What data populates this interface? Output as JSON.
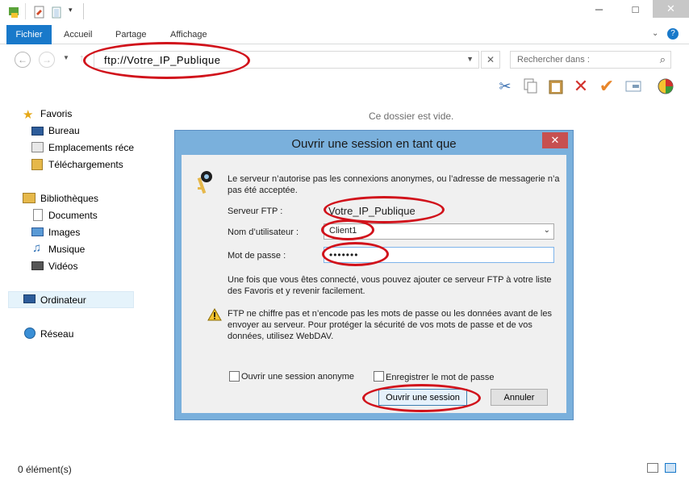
{
  "ribbon": {
    "tabs": [
      "Fichier",
      "Accueil",
      "Partage",
      "Affichage"
    ]
  },
  "window": {
    "minimize": "─",
    "maximize": "□",
    "close": "✕"
  },
  "address": {
    "value": "ftp://Votre_IP_Publique",
    "search_placeholder": "Rechercher dans :"
  },
  "nav": {
    "favorites": "Favoris",
    "fav_items": [
      "Bureau",
      "Emplacements réce",
      "Téléchargements"
    ],
    "libraries": "Bibliothèques",
    "lib_items": [
      "Documents",
      "Images",
      "Musique",
      "Vidéos"
    ],
    "computer": "Ordinateur",
    "network": "Réseau"
  },
  "content": {
    "empty_message": "Ce dossier est vide."
  },
  "status": {
    "item_count": "0 élément(s)"
  },
  "dialog": {
    "title": "Ouvrir une session en tant que",
    "info_line1": "Le serveur n’autorise pas les connexions anonymes, ou l’adresse de messagerie n’a",
    "info_line2": "pas été acceptée.",
    "server_label": "Serveur FTP :",
    "server_value": "Votre_IP_Publique",
    "username_label": "Nom d’utilisateur :",
    "username_value": "Client1",
    "password_label": "Mot de passe :",
    "password_value": "•••••••",
    "hint_line1": "Une fois que vous êtes connecté, vous pouvez ajouter ce serveur FTP à votre liste",
    "hint_line2": "des Favoris et y revenir facilement.",
    "warning_line1": "FTP ne chiffre pas et n’encode pas les mots de passe ou les données avant de les",
    "warning_line2": "envoyer au serveur. Pour protéger la sécurité de vos mots de passe et de vos",
    "warning_line3": "données, utilisez WebDAV.",
    "anonymous_label": "Ouvrir une session anonyme",
    "save_password_label": "Enregistrer le mot de passe",
    "login_button": "Ouvrir une session",
    "cancel_button": "Annuler"
  },
  "colors": {
    "accent": "#1979ca",
    "dialog_frame": "#7ab0dc",
    "highlight_ellipse": "#d1121b",
    "close_red": "#c75050"
  }
}
